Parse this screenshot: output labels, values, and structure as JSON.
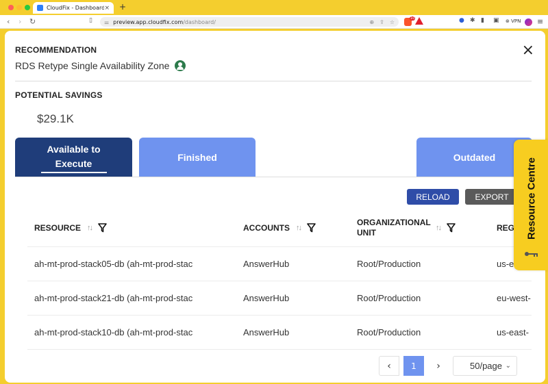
{
  "browser": {
    "tab_title": "CloudFix - Dashboard",
    "tab_close": "×",
    "new_tab": "+",
    "url_host": "preview.app.cloudfix.com",
    "url_path": "/dashboard/",
    "vpn_label": "VPN",
    "brave_badge": "10"
  },
  "modal": {
    "close_glyph": "×",
    "recommendation_label": "RECOMMENDATION",
    "recommendation_name": "RDS Retype Single Availability Zone",
    "savings_label": "POTENTIAL SAVINGS",
    "savings_value": "$29.1K",
    "tabs": {
      "available_line1": "Available to",
      "available_line2": "Execute",
      "finished": "Finished",
      "outdated": "Outdated"
    },
    "actions": {
      "reload": "RELOAD",
      "export": "EXPORT"
    }
  },
  "table": {
    "columns": {
      "resource": "RESOURCE",
      "accounts": "ACCOUNTS",
      "org_unit": "ORGANIZATIONAL UNIT",
      "region": "REGI"
    },
    "rows": [
      {
        "resource": "ah-mt-prod-stack05-db (ah-mt-prod-stac",
        "account": "AnswerHub",
        "org_unit": "Root/Production",
        "region": "us-e"
      },
      {
        "resource": "ah-mt-prod-stack21-db (ah-mt-prod-stac",
        "account": "AnswerHub",
        "org_unit": "Root/Production",
        "region": "eu-west-"
      },
      {
        "resource": "ah-mt-prod-stack10-db (ah-mt-prod-stac",
        "account": "AnswerHub",
        "org_unit": "Root/Production",
        "region": "us-east-"
      }
    ]
  },
  "pagination": {
    "prev": "‹",
    "current_page": "1",
    "next": "›",
    "per_page": "50/page"
  },
  "resource_centre": {
    "label": "Resource Centre"
  },
  "colors": {
    "primary_dark": "#1f3d7a",
    "primary_light": "#6f93ef",
    "reload": "#2f4da8",
    "export": "#5a5a5a",
    "resource_centre": "#f7cd20"
  }
}
